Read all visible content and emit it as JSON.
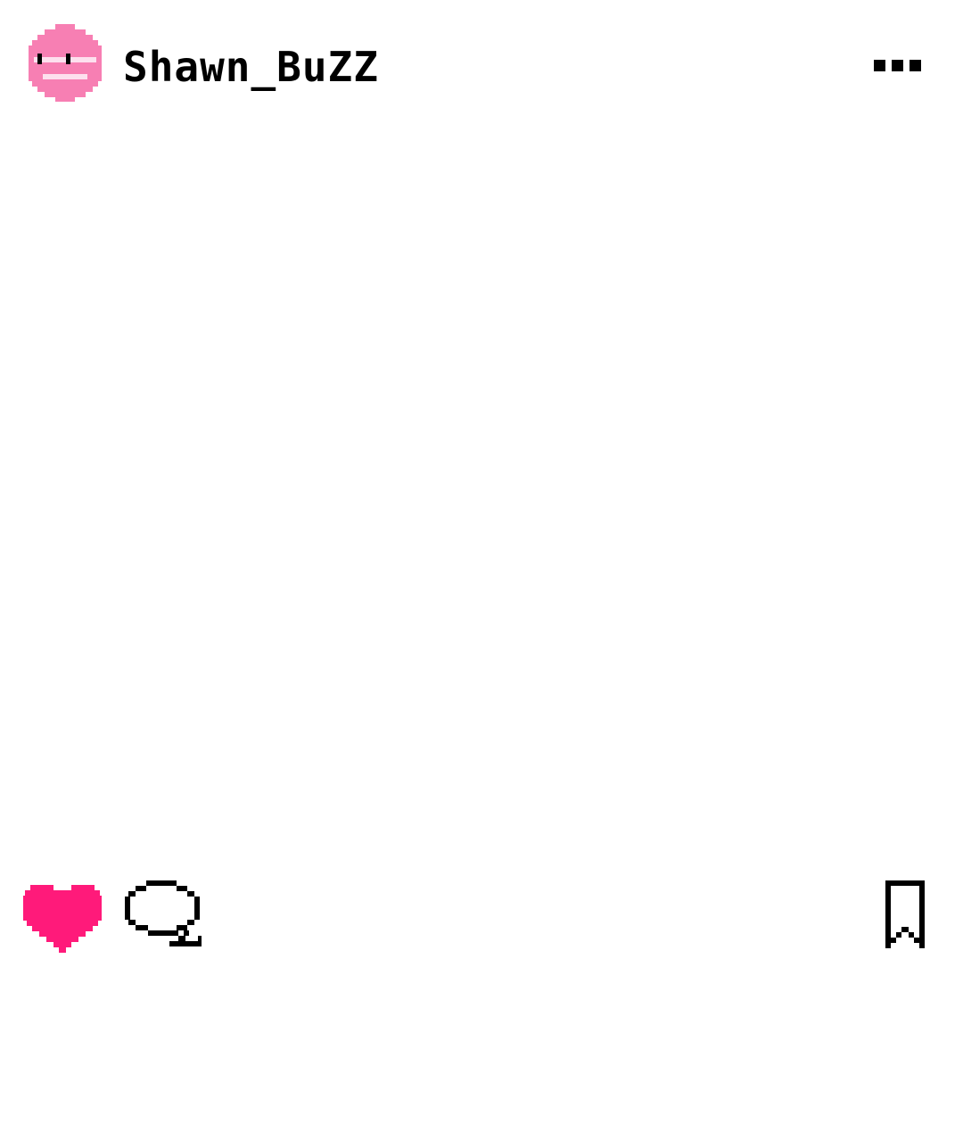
{
  "header": {
    "username": "Shawn_BuZZ",
    "avatar_icon": "pixel-smiley-avatar-icon",
    "more_icon": "more-options-icon"
  },
  "actions": {
    "like_icon": "heart-icon",
    "like_state": "liked",
    "comment_icon": "speech-bubble-icon",
    "save_icon": "bookmark-icon"
  },
  "colors": {
    "avatar_pink": "#f77fb3",
    "avatar_highlight": "#fde0ee",
    "heart_pink": "#ff1a7a",
    "ink": "#000000",
    "background": "#ffffff"
  }
}
